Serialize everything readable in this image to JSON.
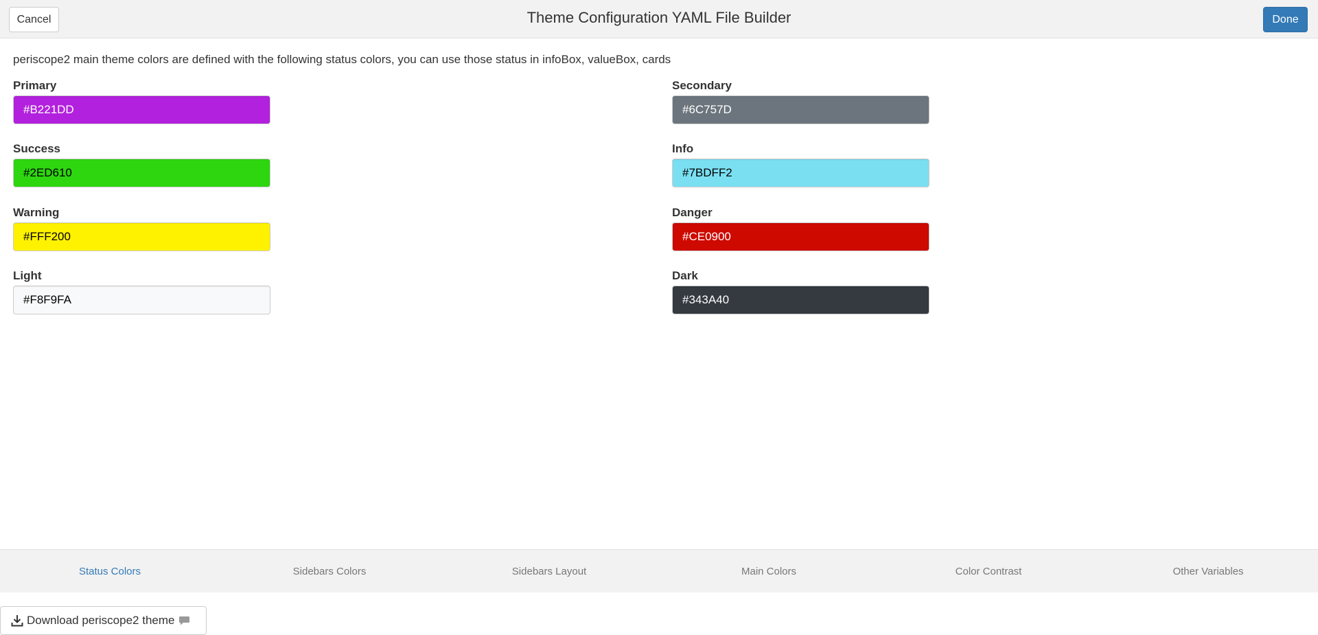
{
  "header": {
    "title": "Theme Configuration YAML File Builder",
    "cancel_label": "Cancel",
    "done_label": "Done"
  },
  "main": {
    "description": "periscope2 main theme colors are defined with the following status colors, you can use those status in infoBox, valueBox, cards",
    "fields": {
      "primary": {
        "label": "Primary",
        "value": "#B221DD",
        "bg": "#B221DD",
        "fg": "#ffffff"
      },
      "secondary": {
        "label": "Secondary",
        "value": "#6C757D",
        "bg": "#6C757D",
        "fg": "#ffffff"
      },
      "success": {
        "label": "Success",
        "value": "#2ED610",
        "bg": "#2ED610",
        "fg": "#000000"
      },
      "info": {
        "label": "Info",
        "value": "#7BDFF2",
        "bg": "#7BDFF2",
        "fg": "#000000"
      },
      "warning": {
        "label": "Warning",
        "value": "#FFF200",
        "bg": "#FFF200",
        "fg": "#000000"
      },
      "danger": {
        "label": "Danger",
        "value": "#CE0900",
        "bg": "#CE0900",
        "fg": "#ffffff"
      },
      "light": {
        "label": "Light",
        "value": "#F8F9FA",
        "bg": "#F8F9FA",
        "fg": "#000000"
      },
      "dark": {
        "label": "Dark",
        "value": "#343A40",
        "bg": "#343A40",
        "fg": "#ffffff"
      }
    }
  },
  "tabs": [
    {
      "label": "Status Colors",
      "active": true
    },
    {
      "label": "Sidebars Colors",
      "active": false
    },
    {
      "label": "Sidebars Layout",
      "active": false
    },
    {
      "label": "Main Colors",
      "active": false
    },
    {
      "label": "Color Contrast",
      "active": false
    },
    {
      "label": "Other Variables",
      "active": false
    }
  ],
  "download": {
    "label": "Download periscope2 theme",
    "icon": "download-icon",
    "secondary_icon": "comment-icon"
  },
  "colors": {
    "accent": "#337ab7",
    "header_bg": "#f2f2f2"
  }
}
